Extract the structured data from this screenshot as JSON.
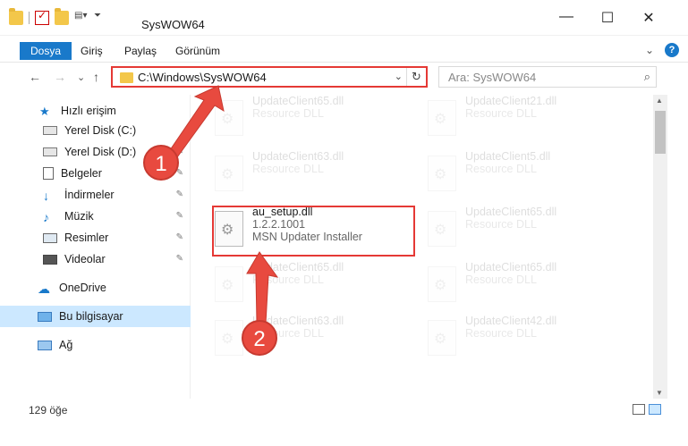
{
  "window": {
    "title": "SysWOW64",
    "minimize": "—",
    "maximize": "☐",
    "close": "✕"
  },
  "ribbon": {
    "tabs": [
      "Dosya",
      "Giriş",
      "Paylaş",
      "Görünüm"
    ],
    "expand": "⌄",
    "help": "?"
  },
  "nav": {
    "back": "←",
    "forward": "→",
    "recent": "⌄",
    "up": "↑",
    "address": "C:\\Windows\\SysWOW64",
    "address_dropdown": "⌄",
    "refresh": "↻",
    "search_placeholder": "Ara: SysWOW64",
    "search_icon": "⌕"
  },
  "sidebar": {
    "items": [
      {
        "label": "Hızlı erişim",
        "icon": "star-icon"
      },
      {
        "label": "Yerel Disk (C:)",
        "icon": "drive-icon"
      },
      {
        "label": "Yerel Disk (D:)",
        "icon": "drive-icon"
      },
      {
        "label": "Belgeler",
        "icon": "document-icon"
      },
      {
        "label": "İndirmeler",
        "icon": "download-icon"
      },
      {
        "label": "Müzik",
        "icon": "music-icon"
      },
      {
        "label": "Resimler",
        "icon": "pictures-icon"
      },
      {
        "label": "Videolar",
        "icon": "video-icon"
      },
      {
        "label": "OneDrive",
        "icon": "cloud-icon"
      },
      {
        "label": "Bu bilgisayar",
        "icon": "computer-icon"
      },
      {
        "label": "Ağ",
        "icon": "network-icon"
      }
    ],
    "pin_glyph": "📌"
  },
  "files": {
    "col1": [
      {
        "name": "UpdateClient65.dll",
        "sub": "Resource DLL"
      },
      {
        "name": "UpdateClient63.dll",
        "sub": "Resource DLL"
      },
      {
        "name": "au_setup.dll",
        "version": "1.2.2.1001",
        "sub": "MSN Updater Installer"
      },
      {
        "name": "UpdateClient65.dll",
        "sub": "Resource DLL"
      },
      {
        "name": "UpdateClient63.dll",
        "sub": "Resource DLL"
      }
    ],
    "col2": [
      {
        "name": "UpdateClient21.dll",
        "sub": "Resource DLL"
      },
      {
        "name": "UpdateClient5.dll",
        "sub": "Resource DLL"
      },
      {
        "name": "UpdateClient65.dll",
        "sub": "Resource DLL"
      },
      {
        "name": "UpdateClient65.dll",
        "sub": "Resource DLL"
      },
      {
        "name": "UpdateClient42.dll",
        "sub": "Resource DLL"
      }
    ]
  },
  "status": {
    "count": "129 öğe"
  },
  "callouts": {
    "one": "1",
    "two": "2"
  },
  "colors": {
    "accent": "#1979ca",
    "highlight": "#e53935",
    "callout": "#e84a3f",
    "selection": "#cce8ff"
  }
}
